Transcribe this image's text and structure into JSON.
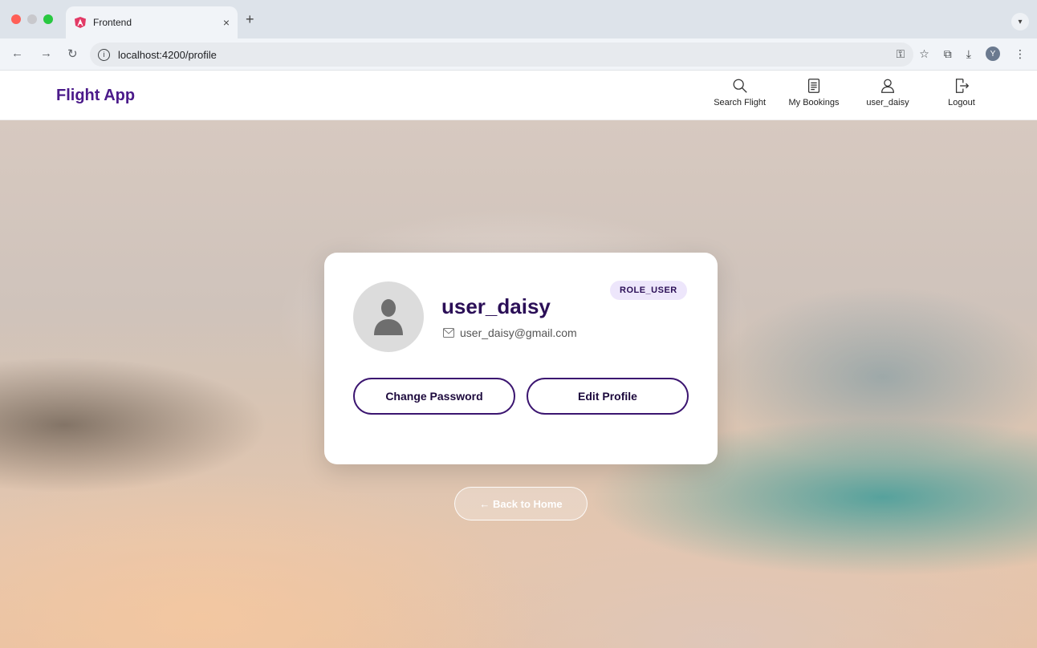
{
  "browser": {
    "tab_title": "Frontend",
    "tab_close": "×",
    "new_tab": "+",
    "url": "localhost:4200/profile",
    "profile_initial": "Y"
  },
  "header": {
    "brand": "Flight App",
    "nav": [
      {
        "label": "Search Flight",
        "icon": "search-icon"
      },
      {
        "label": "My Bookings",
        "icon": "bookings-icon"
      },
      {
        "label": "user_daisy",
        "icon": "user-icon"
      },
      {
        "label": "Logout",
        "icon": "logout-icon"
      }
    ]
  },
  "profile": {
    "username": "user_daisy",
    "email": "user_daisy@gmail.com",
    "role": "ROLE_USER",
    "change_password_label": "Change Password",
    "edit_profile_label": "Edit Profile"
  },
  "back_label": "← Back to Home",
  "colors": {
    "brand": "#4b1a8a",
    "primary_dark": "#2b0f57",
    "badge_bg": "#ede6fb"
  }
}
